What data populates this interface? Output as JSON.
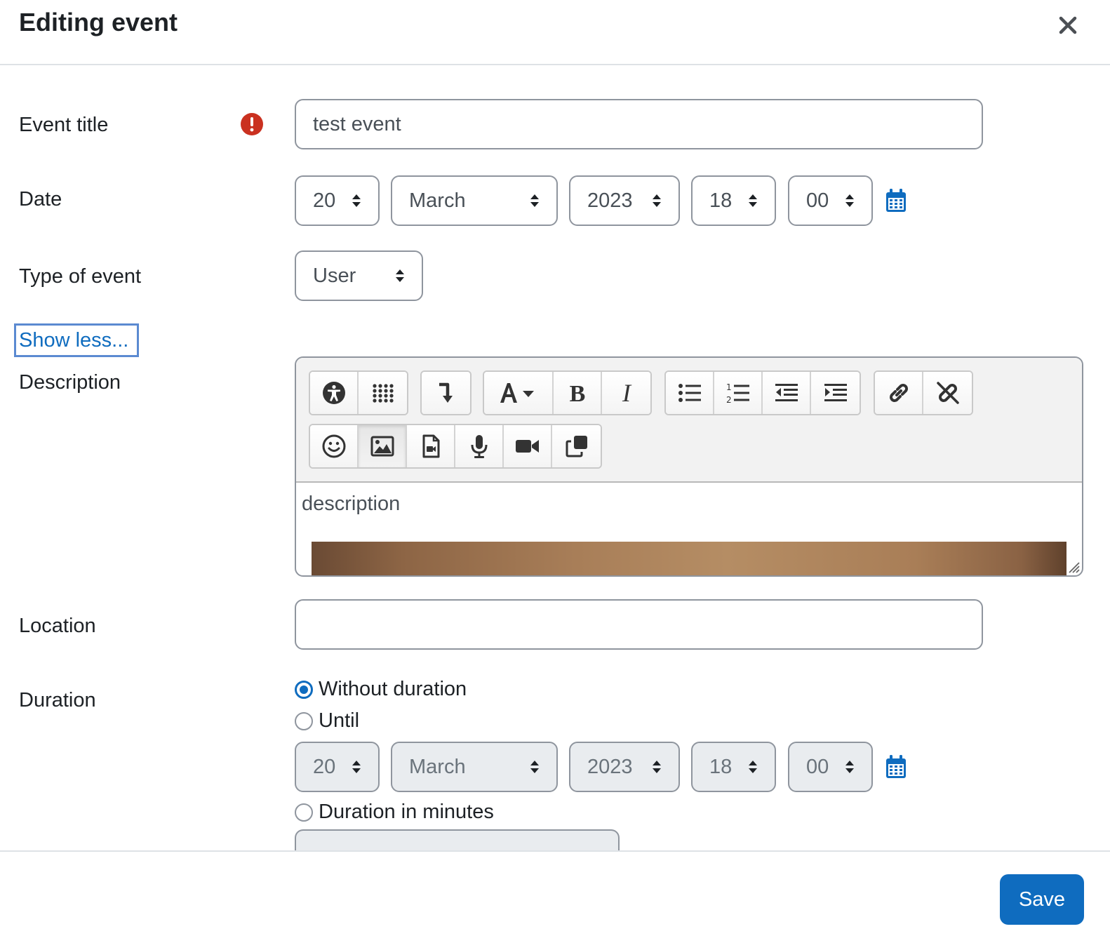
{
  "modal": {
    "title": "Editing event",
    "save_label": "Save"
  },
  "form": {
    "event_title": {
      "label": "Event title",
      "value": "test event"
    },
    "date": {
      "label": "Date",
      "day": "20",
      "month": "March",
      "year": "2023",
      "hour": "18",
      "minute": "00"
    },
    "type_of_event": {
      "label": "Type of event",
      "value": "User"
    },
    "show_less_label": "Show less...",
    "description": {
      "label": "Description",
      "content": "description"
    },
    "location": {
      "label": "Location",
      "value": ""
    },
    "duration": {
      "label": "Duration",
      "options": [
        "Without duration",
        "Until",
        "Duration in minutes"
      ],
      "selected": "Without duration",
      "until": {
        "day": "20",
        "month": "March",
        "year": "2023",
        "hour": "18",
        "minute": "00"
      }
    }
  },
  "editor_toolbar": {
    "row1": [
      "accessibility-checker",
      "more-buttons",
      "insert-special-char",
      "font-style",
      "bold",
      "italic",
      "unordered-list",
      "ordered-list",
      "outdent",
      "indent",
      "link",
      "unlink"
    ],
    "row2": [
      "emoji",
      "image",
      "media",
      "record-audio",
      "record-video",
      "manage-files"
    ]
  },
  "colors": {
    "accent": "#0f6cbf",
    "error": "#ca3120",
    "border": "#8f959e",
    "toolbar_bg": "#f2f2f2"
  }
}
